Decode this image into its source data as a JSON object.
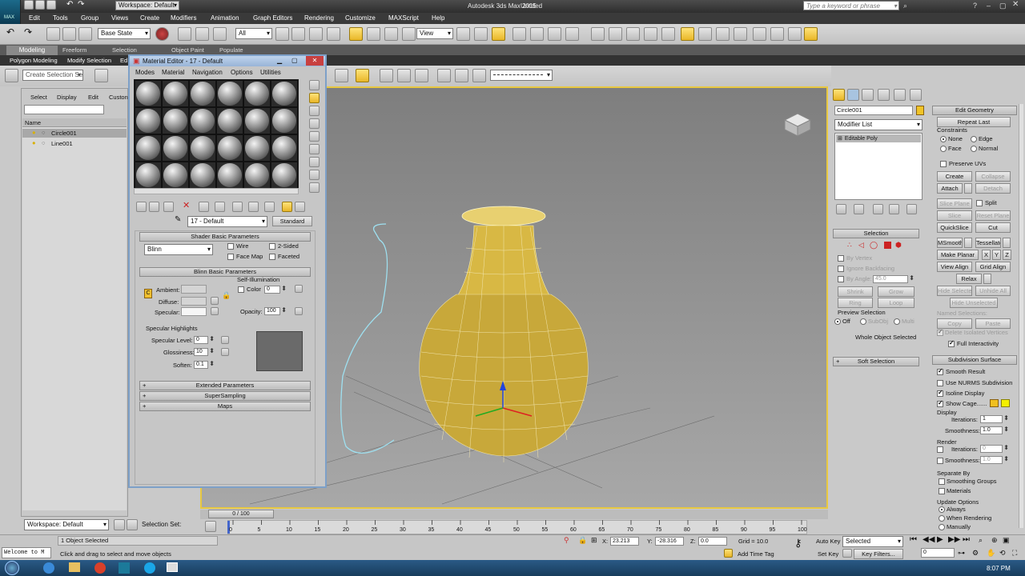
{
  "titlebar": {
    "workspace": "Workspace: Default",
    "title": "Autodesk 3ds Max 2015",
    "doc": "Untitled",
    "search_placeholder": "Type a keyword or phrase",
    "max_label": "MAX"
  },
  "menu": [
    "Edit",
    "Tools",
    "Group",
    "Views",
    "Create",
    "Modifiers",
    "Animation",
    "Graph Editors",
    "Rendering",
    "Customize",
    "MAXScript",
    "Help"
  ],
  "toolbar": {
    "selset": "Base State",
    "filter": "All",
    "refcoord": "View",
    "named_sel": "Create Selection Se"
  },
  "ribbon": {
    "tabs": [
      "Modeling",
      "Freeform",
      "Selection",
      "Object Paint",
      "Populate"
    ],
    "panels": [
      "Polygon Modeling",
      "Modify Selection",
      "Ed"
    ]
  },
  "scene_explorer": {
    "menus": [
      "Select",
      "Display",
      "Edit",
      "Custon"
    ],
    "col_name": "Name",
    "items": [
      "Circle001",
      "Line001"
    ]
  },
  "material_editor": {
    "title": "Material Editor - 17 - Default",
    "menus": [
      "Modes",
      "Material",
      "Navigation",
      "Options",
      "Utilities"
    ],
    "mat_name": "17 - Default",
    "mat_type": "Standard",
    "shader": {
      "header": "Shader Basic Parameters",
      "type": "Blinn",
      "wire": "Wire",
      "two_sided": "2-Sided",
      "face_map": "Face Map",
      "faceted": "Faceted"
    },
    "blinn": {
      "header": "Blinn Basic Parameters",
      "self_illum": "Self-Illumination",
      "color_label": "Color",
      "color_val": "0",
      "ambient": "Ambient:",
      "diffuse": "Diffuse:",
      "specular": "Specular:",
      "opacity_label": "Opacity:",
      "opacity_val": "100",
      "c_label": "C"
    },
    "highlights": {
      "header": "Specular Highlights",
      "level_label": "Specular Level:",
      "level_val": "0",
      "gloss_label": "Glossiness:",
      "gloss_val": "10",
      "soften_label": "Soften:",
      "soften_val": "0.1"
    },
    "rollouts": [
      "Extended Parameters",
      "SuperSampling",
      "Maps"
    ]
  },
  "command_panel": {
    "obj_name": "Circle001",
    "modifier_list": "Modifier List",
    "stack_item": "Editable Poly",
    "selection": {
      "header": "Selection",
      "by_vertex": "By Vertex",
      "ignore_back": "Ignore Backfacing",
      "by_angle": "By Angle:",
      "angle_val": "45.0",
      "shrink": "Shrink",
      "grow": "Grow",
      "ring": "Ring",
      "loop": "Loop",
      "preview": "Preview Selection",
      "off": "Off",
      "subobj": "SubObj",
      "multi": "Multi",
      "status": "Whole Object Selected"
    },
    "soft_selection": "Soft Selection",
    "edit_geometry": {
      "header": "Edit Geometry",
      "repeat_last": "Repeat Last",
      "constraints": "Constraints",
      "none": "None",
      "edge": "Edge",
      "face": "Face",
      "normal": "Normal",
      "preserve_uvs": "Preserve UVs",
      "create": "Create",
      "collapse": "Collapse",
      "attach": "Attach",
      "detach": "Detach",
      "slice_plane": "Slice Plane",
      "split": "Split",
      "slice": "Slice",
      "reset_plane": "Reset Plane",
      "quickslice": "QuickSlice",
      "cut": "Cut",
      "msmooth": "MSmooth",
      "tessellate": "Tessellate",
      "make_planar": "Make Planar",
      "x": "X",
      "y": "Y",
      "z": "Z",
      "view_align": "View Align",
      "grid_align": "Grid Align",
      "relax": "Relax",
      "hide_selected": "Hide Selected",
      "unhide_all": "Unhide All",
      "hide_unselected": "Hide Unselected",
      "named_selections": "Named Selections:",
      "copy": "Copy",
      "paste": "Paste",
      "delete_isolated": "Delete Isolated Vertices",
      "full_interactivity": "Full Interactivity"
    },
    "subdivision": {
      "header": "Subdivision Surface",
      "smooth_result": "Smooth Result",
      "use_nurms": "Use NURMS Subdivision",
      "isoline": "Isoline Display",
      "show_cage": "Show Cage......",
      "display": "Display",
      "iterations_label": "Iterations:",
      "iter_val": "1",
      "smoothness_label": "Smoothness:",
      "smooth_val": "1.0",
      "render": "Render",
      "r_iter_val": "0",
      "r_smooth_val": "1.0",
      "separate_by": "Separate By",
      "smoothing_groups": "Smoothing Groups",
      "materials": "Materials",
      "update_options": "Update Options",
      "always": "Always",
      "when_rendering": "When Rendering",
      "manually": "Manually"
    }
  },
  "timeline": {
    "slider": "0 / 100",
    "ticks": [
      "0",
      "5",
      "10",
      "15",
      "20",
      "25",
      "30",
      "35",
      "40",
      "45",
      "50",
      "55",
      "60",
      "65",
      "70",
      "75",
      "80",
      "85",
      "90",
      "95",
      "100"
    ],
    "frames": [
      0,
      5,
      10,
      15,
      20,
      25,
      30,
      35,
      40,
      45,
      50,
      55,
      60,
      65,
      70,
      75,
      80,
      85,
      90,
      95,
      100
    ],
    "frame_max": 100
  },
  "statusbar": {
    "workspace": "Workspace: Default",
    "selection_set": "Selection Set:",
    "objects": "1 Object Selected",
    "prompt": "Click and drag to select and move objects",
    "listener": "Welcome to M",
    "x_label": "X:",
    "x": "23.213",
    "y_label": "Y:",
    "y": "-28.316",
    "z_label": "Z:",
    "z": "0.0",
    "grid": "Grid = 10.0",
    "add_time_tag": "Add Time Tag",
    "auto_key": "Auto Key",
    "set_key": "Set Key",
    "key_mode": "Selected",
    "key_filters": "Key Filters...",
    "frame": "0"
  },
  "taskbar": {
    "time": "8:07 PM"
  },
  "colors": {
    "bg": "#c9c9c9",
    "titlebar": "#3a3a3a",
    "viewport": "#8f8f8f",
    "accent": "#f5d25a",
    "vase": "#c8a83a"
  }
}
